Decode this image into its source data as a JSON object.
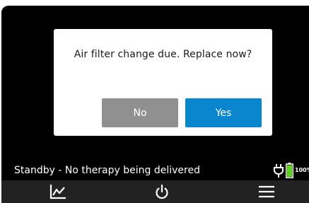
{
  "dialog": {
    "message": "Air filter change due. Replace now?",
    "no_label": "No",
    "yes_label": "Yes"
  },
  "status": {
    "text": "Standby - No therapy being delivered",
    "battery_text": "100%",
    "battery_level": 1.0
  },
  "nav": {
    "items": [
      {
        "icon": "trend-chart-icon"
      },
      {
        "icon": "power-icon"
      },
      {
        "icon": "menu-icon"
      }
    ]
  },
  "colors": {
    "background": "#000000",
    "dialog": "#ffffff",
    "no_button": "#909090",
    "yes_button": "#0a86cf",
    "battery": "#5fd41c",
    "nav_bar": "#222222"
  }
}
